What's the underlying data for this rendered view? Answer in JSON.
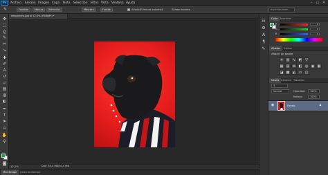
{
  "app": {
    "logo": "Ps"
  },
  "menu": [
    "Archivo",
    "Edición",
    "Imagen",
    "Capa",
    "Texto",
    "Selección",
    "Filtro",
    "Vista",
    "Ventana",
    "Ayuda"
  ],
  "window_controls": [
    "–",
    "▢",
    "✕"
  ],
  "options_bar": {
    "buttons": [
      "Fundido",
      "Marcos",
      "Selección",
      "Máscara",
      "Fuente"
    ],
    "checkbox_label": "Añadir/Eliminar automát.",
    "extra_label": "Alinear bordes",
    "workspace": "Aspectos esen..."
  },
  "document": {
    "tab_title": "despairdro.jpg al 12,1% (RGB/8*) *",
    "zoom": "12,2%",
    "info": "Doc: 30,4 MB/30,4 MB"
  },
  "bottom_tabs": [
    "Mini Bridge",
    "Línea de tiempo"
  ],
  "color_panel": {
    "tabs": [
      "Color",
      "Muestras"
    ],
    "sliders": [
      {
        "label": "R",
        "value": "0",
        "color": "#e33"
      },
      {
        "label": "G",
        "value": "0",
        "color": "#3c3"
      },
      {
        "label": "B",
        "value": "0",
        "color": "#36f"
      }
    ]
  },
  "adjust_panel": {
    "tabs": [
      "Ajustes",
      "Estilos"
    ],
    "title": "Añadir un ajuste",
    "row1_icons": [
      "brightness-icon",
      "levels-icon",
      "curves-icon",
      "exposure-icon",
      "triangle-icon"
    ],
    "row2_icons": [
      "vibrance-icon",
      "hue-icon",
      "balance-icon",
      "bw-icon",
      "photo-filter-icon",
      "channel-icon",
      "grid-icon"
    ],
    "row3_icons": [
      "invert-icon",
      "posterize-icon",
      "threshold-icon",
      "gradient-map-icon",
      "selective-color-icon"
    ]
  },
  "layers_panel": {
    "tabs": [
      "Capas",
      "Canales",
      "Trazados"
    ],
    "kind": "Normal",
    "opacity_label": "Opacidad:",
    "opacity": "100%",
    "fill_label": "Relleno:",
    "fill": "100%",
    "layer_name": "Fondo"
  },
  "tools": [
    "move-icon",
    "marquee-icon",
    "lasso-icon",
    "quick-select-icon",
    "crop-icon",
    "eyedropper-icon",
    "healing-icon",
    "brush-icon",
    "clone-stamp-icon",
    "history-brush-icon",
    "eraser-icon",
    "gradient-icon",
    "blur-icon",
    "dodge-icon",
    "pen-icon",
    "type-icon",
    "path-select-icon",
    "shape-icon",
    "hand-icon",
    "zoom-icon"
  ],
  "right_strip_icons": [
    "history-icon",
    "properties-icon",
    "character-icon",
    "paragraph-icon",
    "brush-preset-icon"
  ],
  "colors": {
    "foreground": "#17a54a",
    "background": "#ffffff",
    "photo_red": "#e41d1d"
  }
}
